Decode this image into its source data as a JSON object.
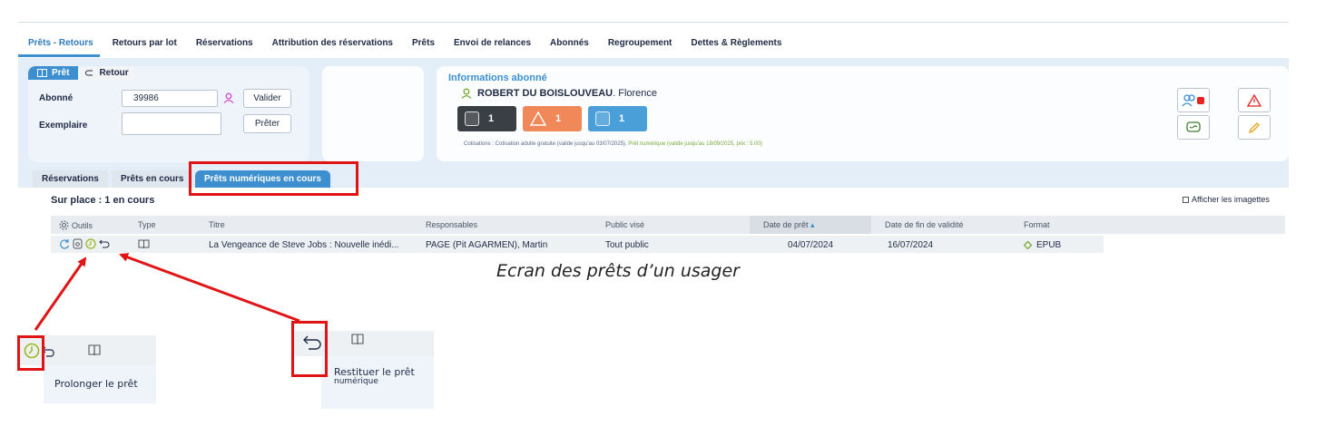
{
  "nav": {
    "items": [
      "Prêts - Retours",
      "Retours par lot",
      "Réservations",
      "Attribution des réservations",
      "Prêts",
      "Envoi de relances",
      "Abonnés",
      "Regroupement",
      "Dettes & Règlements"
    ],
    "active_index": 0
  },
  "loan_form": {
    "toggle_pret": "Prêt",
    "toggle_retour": "Retour",
    "abonne_label": "Abonné",
    "abonne_value": "39986",
    "valider_label": "Valider",
    "exemplaire_label": "Exemplaire",
    "exemplaire_value": "",
    "preter_label": "Prêter"
  },
  "subscriber": {
    "section_title": "Informations abonné",
    "last_name": "ROBERT DU BOISLOUVEAU",
    "first_name": ". Florence",
    "counters": [
      {
        "value": "1",
        "color": "#3a3f45"
      },
      {
        "value": "1",
        "color": "#f0885a"
      },
      {
        "value": "1",
        "color": "#4a9fd8"
      }
    ],
    "cotisation_text": "Cotisations : Cotisation adulte gratuite (valide jusqu'au 03/07/2025), ",
    "pret_numerique_text": "Prêt numérique (valide jusqu'au 18/09/2025, prix : 5.00)"
  },
  "subtabs": {
    "items": [
      "Réservations",
      "Prêts en cours",
      "Prêts numériques en cours"
    ],
    "active_index": 2
  },
  "list": {
    "title": "Sur place : 1 en cours",
    "imagettes_label": "Afficher les imagettes",
    "columns": {
      "outils": "Outils",
      "type": "Type",
      "titre": "Titre",
      "responsables": "Responsables",
      "public": "Public visé",
      "date_pret": "Date de prêt",
      "date_fin": "Date de fin de validité",
      "format": "Format"
    },
    "rows": [
      {
        "titre": "La Vengeance de Steve Jobs : Nouvelle inédi...",
        "responsables": "PAGE (Pit AGARMEN), Martin",
        "public": "Tout public",
        "date_pret": "04/07/2024",
        "date_fin": "16/07/2024",
        "format": "EPUB"
      }
    ]
  },
  "caption": "Ecran des prêts d’un usager",
  "insets": {
    "prolonger": "Prolonger le prêt",
    "restituer_line1": "Restituer le prêt",
    "restituer_line2": "numérique"
  },
  "colors": {
    "accent": "#3d8fd0",
    "highlight": "#e01414",
    "green": "#7aaa36"
  }
}
